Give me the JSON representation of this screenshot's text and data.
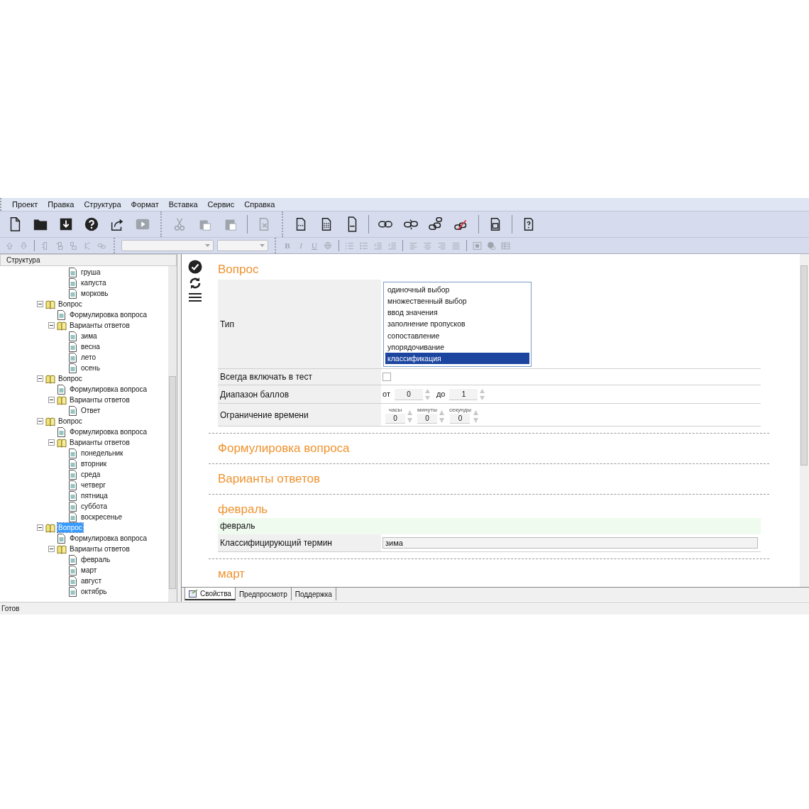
{
  "menu": [
    {
      "label": "Проект"
    },
    {
      "label": "Правка"
    },
    {
      "label": "Структура"
    },
    {
      "label": "Формат"
    },
    {
      "label": "Вставка"
    },
    {
      "label": "Сервис"
    },
    {
      "label": "Справка"
    }
  ],
  "toolbar_main": [
    {
      "kind": "new",
      "disabled": false
    },
    {
      "kind": "open",
      "disabled": false
    },
    {
      "kind": "save",
      "disabled": false
    },
    {
      "kind": "help",
      "disabled": false
    },
    {
      "kind": "export",
      "disabled": false
    },
    {
      "kind": "play",
      "disabled": true
    },
    {
      "kind": "grip"
    },
    {
      "kind": "cut",
      "disabled": true
    },
    {
      "kind": "copy",
      "disabled": true
    },
    {
      "kind": "paste",
      "disabled": true
    },
    {
      "kind": "separator"
    },
    {
      "kind": "find",
      "disabled": true
    },
    {
      "kind": "grip"
    },
    {
      "kind": "page",
      "disabled": false
    },
    {
      "kind": "page-lines",
      "disabled": false
    },
    {
      "kind": "page-tall",
      "disabled": false
    },
    {
      "kind": "separator"
    },
    {
      "kind": "link",
      "disabled": false
    },
    {
      "kind": "unlink",
      "disabled": false
    },
    {
      "kind": "link-multi",
      "disabled": false
    },
    {
      "kind": "link-remove",
      "disabled": false
    },
    {
      "kind": "separator"
    },
    {
      "kind": "page-image",
      "disabled": false
    },
    {
      "kind": "separator"
    },
    {
      "kind": "page-question",
      "disabled": false
    }
  ],
  "toolbar_format": [
    {
      "kind": "up",
      "disabled": true
    },
    {
      "kind": "down",
      "disabled": true
    },
    {
      "kind": "separator"
    },
    {
      "kind": "ins-before",
      "disabled": true
    },
    {
      "kind": "ins-after",
      "disabled": true
    },
    {
      "kind": "ins-child",
      "disabled": true
    },
    {
      "kind": "cut-node",
      "disabled": true
    },
    {
      "kind": "small-link",
      "disabled": true
    },
    {
      "kind": "grip"
    },
    {
      "kind": "combo-wide",
      "disabled": true
    },
    {
      "kind": "combo",
      "disabled": true
    },
    {
      "kind": "grip"
    },
    {
      "kind": "bold",
      "label": "B",
      "disabled": true
    },
    {
      "kind": "italic",
      "label": "I",
      "disabled": true
    },
    {
      "kind": "underline",
      "label": "U",
      "disabled": true
    },
    {
      "kind": "globe",
      "disabled": true
    },
    {
      "kind": "separator"
    },
    {
      "kind": "ol",
      "disabled": true
    },
    {
      "kind": "ul",
      "disabled": true
    },
    {
      "kind": "outdent",
      "disabled": true
    },
    {
      "kind": "indent",
      "disabled": true
    },
    {
      "kind": "separator"
    },
    {
      "kind": "align-left",
      "disabled": true
    },
    {
      "kind": "align-center",
      "disabled": true
    },
    {
      "kind": "align-right",
      "disabled": true
    },
    {
      "kind": "justify",
      "disabled": true
    },
    {
      "kind": "separator"
    },
    {
      "kind": "image",
      "disabled": true
    },
    {
      "kind": "web",
      "disabled": true
    },
    {
      "kind": "table",
      "disabled": true
    }
  ],
  "structure_panel": {
    "title": "Структура",
    "continued_items": [
      {
        "label": "груша"
      },
      {
        "label": "капуста"
      },
      {
        "label": "морковь"
      }
    ],
    "tree": [
      {
        "label": "Вопрос",
        "kind": "folder",
        "expanded": true,
        "selected": false,
        "children": [
          {
            "label": "Формулировка вопроса",
            "kind": "page",
            "selected": false
          },
          {
            "label": "Варианты ответов",
            "kind": "folder",
            "expanded": true,
            "selected": false,
            "children": [
              {
                "label": "зима",
                "kind": "page",
                "selected": false
              },
              {
                "label": "весна",
                "kind": "page",
                "selected": false
              },
              {
                "label": "лето",
                "kind": "page",
                "selected": false
              },
              {
                "label": "осень",
                "kind": "page",
                "selected": false
              }
            ]
          }
        ]
      },
      {
        "label": "Вопрос",
        "kind": "folder",
        "expanded": true,
        "selected": false,
        "children": [
          {
            "label": "Формулировка вопроса",
            "kind": "page",
            "selected": false
          },
          {
            "label": "Варианты ответов",
            "kind": "folder",
            "expanded": true,
            "selected": false,
            "children": [
              {
                "label": "Ответ",
                "kind": "page",
                "selected": false
              }
            ]
          }
        ]
      },
      {
        "label": "Вопрос",
        "kind": "folder",
        "expanded": true,
        "selected": false,
        "children": [
          {
            "label": "Формулировка вопроса",
            "kind": "page",
            "selected": false
          },
          {
            "label": "Варианты ответов",
            "kind": "folder",
            "expanded": true,
            "selected": false,
            "children": [
              {
                "label": "понедельник",
                "kind": "page",
                "selected": false
              },
              {
                "label": "вторник",
                "kind": "page",
                "selected": false
              },
              {
                "label": "среда",
                "kind": "page",
                "selected": false
              },
              {
                "label": "четверг",
                "kind": "page",
                "selected": false
              },
              {
                "label": "пятница",
                "kind": "page",
                "selected": false
              },
              {
                "label": "суббота",
                "kind": "page",
                "selected": false
              },
              {
                "label": "воскресенье",
                "kind": "page",
                "selected": false
              }
            ]
          }
        ]
      },
      {
        "label": "Вопрос",
        "kind": "folder",
        "expanded": true,
        "selected": true,
        "children": [
          {
            "label": "Формулировка вопроса",
            "kind": "page",
            "selected": false
          },
          {
            "label": "Варианты ответов",
            "kind": "folder",
            "expanded": true,
            "selected": false,
            "children": [
              {
                "label": "февраль",
                "kind": "page",
                "selected": false
              },
              {
                "label": "март",
                "kind": "page",
                "selected": false
              },
              {
                "label": "август",
                "kind": "page",
                "selected": false
              },
              {
                "label": "октябрь",
                "kind": "page",
                "selected": false
              }
            ]
          }
        ]
      }
    ]
  },
  "editor": {
    "title": "Вопрос",
    "properties": [
      {
        "kind": "listbox",
        "label": "Тип",
        "options": [
          {
            "label": "одиночный выбор",
            "selected": false
          },
          {
            "label": "множественный выбор",
            "selected": false
          },
          {
            "label": "ввод значения",
            "selected": false
          },
          {
            "label": "заполнение пропусков",
            "selected": false
          },
          {
            "label": "сопоставление",
            "selected": false
          },
          {
            "label": "упорядочивание",
            "selected": false
          },
          {
            "label": "классификация",
            "selected": true
          }
        ]
      },
      {
        "kind": "checkbox",
        "label": "Всегда включать в тест",
        "checked": false
      },
      {
        "kind": "range",
        "label": "Диапазон баллов",
        "from_label": "от",
        "from": "0",
        "to_label": "до",
        "to": "1"
      },
      {
        "kind": "time",
        "label": "Ограничение времени",
        "fields": [
          {
            "caption": "часы",
            "value": "0"
          },
          {
            "caption": "минуты",
            "value": "0"
          },
          {
            "caption": "секунды",
            "value": "0"
          }
        ]
      }
    ],
    "sections": [
      {
        "title": "Формулировка вопроса"
      },
      {
        "title": "Варианты ответов"
      },
      {
        "title": "февраль",
        "text": "февраль",
        "term_label": "Классифицирующий термин",
        "term": "зима"
      },
      {
        "title": "март"
      }
    ]
  },
  "tabs": [
    {
      "label": "Свойства",
      "selected": true
    },
    {
      "label": "Предпросмотр",
      "selected": false
    },
    {
      "label": "Поддержка",
      "selected": false
    }
  ],
  "status_bar": "Готов"
}
